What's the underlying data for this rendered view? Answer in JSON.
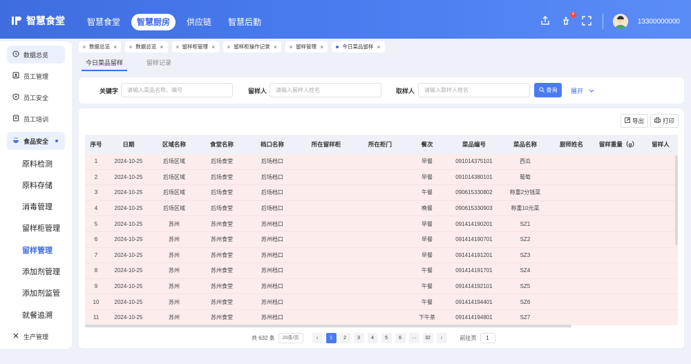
{
  "app": {
    "name": "智慧食堂"
  },
  "top_nav": [
    {
      "label": "智慧食堂",
      "active": false
    },
    {
      "label": "智慧厨房",
      "active": true
    },
    {
      "label": "供应链",
      "active": false
    },
    {
      "label": "智慧后勤",
      "active": false
    }
  ],
  "header": {
    "notification_count": "4",
    "user_phone": "13300000000"
  },
  "sidebar": {
    "items": [
      {
        "label": "数据总览",
        "icon": "clock-icon"
      },
      {
        "label": "员工管理",
        "icon": "id-card-icon"
      },
      {
        "label": "员工安全",
        "icon": "shield-icon"
      },
      {
        "label": "员工培训",
        "icon": "book-icon"
      },
      {
        "label": "食品安全",
        "icon": "bowl-icon"
      },
      {
        "label": "生产管理",
        "icon": "tools-icon"
      }
    ],
    "sub_items": [
      {
        "label": "原料检测",
        "active": false
      },
      {
        "label": "原料存储",
        "active": false
      },
      {
        "label": "消毒管理",
        "active": false
      },
      {
        "label": "留样柜管理",
        "active": false
      },
      {
        "label": "留样管理",
        "active": true
      },
      {
        "label": "添加剂管理",
        "active": false
      },
      {
        "label": "添加剂监管",
        "active": false
      },
      {
        "label": "就餐追溯",
        "active": false
      }
    ]
  },
  "tabs": [
    {
      "label": "数据总览",
      "active": false
    },
    {
      "label": "数据总览",
      "active": false
    },
    {
      "label": "留样柜管理",
      "active": false
    },
    {
      "label": "留样柜操作记录",
      "active": false
    },
    {
      "label": "留样管理",
      "active": false
    },
    {
      "label": "今日菜品留样",
      "active": true
    }
  ],
  "sub_tabs": [
    {
      "label": "今日菜品留样",
      "active": true
    },
    {
      "label": "留样记录",
      "active": false
    }
  ],
  "filters": {
    "keyword_label": "关键字",
    "keyword_placeholder": "请输入菜品名称、编号",
    "sampler_label": "留样人",
    "sampler_placeholder": "请输入留样人姓名",
    "taker_label": "取样人",
    "taker_placeholder": "请输入取样人姓名",
    "query_label": "查询",
    "expand_label": "展开"
  },
  "toolbar": {
    "export_label": "导出",
    "print_label": "打印"
  },
  "table": {
    "columns": [
      "序号",
      "日期",
      "区域名称",
      "食堂名称",
      "档口名称",
      "所在留样柜",
      "所在柜门",
      "餐次",
      "菜品编号",
      "菜品名称",
      "厨师姓名",
      "留样重量（g）",
      "留样人"
    ],
    "rows": [
      [
        "1",
        "2024-10-25",
        "后场区域",
        "后场食堂",
        "后场档口",
        "",
        "",
        "早餐",
        "091014375101",
        "西瓜",
        "",
        "",
        ""
      ],
      [
        "2",
        "2024-10-25",
        "后场区域",
        "后场食堂",
        "后场档口",
        "",
        "",
        "早餐",
        "091014380101",
        "葡萄",
        "",
        "",
        ""
      ],
      [
        "3",
        "2024-10-25",
        "后场区域",
        "后场食堂",
        "后场档口",
        "",
        "",
        "午餐",
        "090615330802",
        "称重2分钱菜",
        "",
        "",
        ""
      ],
      [
        "4",
        "2024-10-25",
        "后场区域",
        "后场食堂",
        "后场档口",
        "",
        "",
        "晚餐",
        "090615330903",
        "称重10元菜",
        "",
        "",
        ""
      ],
      [
        "5",
        "2024-10-25",
        "苏州",
        "苏州食堂",
        "苏州档口",
        "",
        "",
        "早餐",
        "091414190201",
        "SZ1",
        "",
        "",
        ""
      ],
      [
        "6",
        "2024-10-25",
        "苏州",
        "苏州食堂",
        "苏州档口",
        "",
        "",
        "早餐",
        "091414190701",
        "SZ2",
        "",
        "",
        ""
      ],
      [
        "7",
        "2024-10-25",
        "苏州",
        "苏州食堂",
        "苏州档口",
        "",
        "",
        "早餐",
        "091414191201",
        "SZ3",
        "",
        "",
        ""
      ],
      [
        "8",
        "2024-10-25",
        "苏州",
        "苏州食堂",
        "苏州档口",
        "",
        "",
        "午餐",
        "091414191701",
        "SZ4",
        "",
        "",
        ""
      ],
      [
        "9",
        "2024-10-25",
        "苏州",
        "苏州食堂",
        "苏州档口",
        "",
        "",
        "午餐",
        "091414192101",
        "SZ5",
        "",
        "",
        ""
      ],
      [
        "10",
        "2024-10-25",
        "苏州",
        "苏州食堂",
        "苏州档口",
        "",
        "",
        "午餐",
        "091414194401",
        "SZ6",
        "",
        "",
        ""
      ],
      [
        "11",
        "2024-10-25",
        "苏州",
        "苏州食堂",
        "苏州档口",
        "",
        "",
        "下午茶",
        "091414194801",
        "SZ7",
        "",
        "",
        ""
      ]
    ]
  },
  "pagination": {
    "total_text": "共 632 条",
    "page_size": "20条/页",
    "prev": "‹",
    "next": "›",
    "pages": [
      "1",
      "2",
      "3",
      "4",
      "5",
      "6",
      "···",
      "32"
    ],
    "current": "1",
    "goto_label": "前往页",
    "goto_value": "1"
  },
  "colors": {
    "primary": "#4a7cf0",
    "header": "#3f6de0",
    "row_bg": "#fcecec",
    "badge": "#f04b4b"
  }
}
